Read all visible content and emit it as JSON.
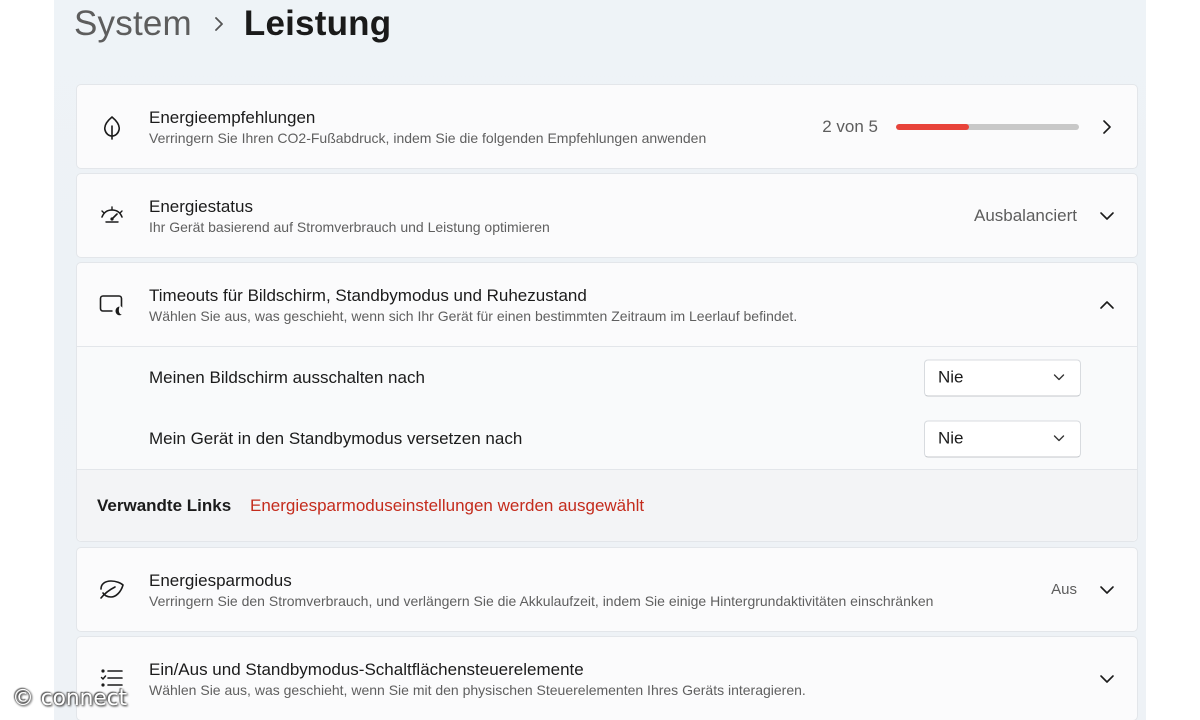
{
  "breadcrumb": {
    "parent": "System",
    "current": "Leistung"
  },
  "cards": {
    "recommendations": {
      "icon": "leaf-icon",
      "title": "Energieempfehlungen",
      "subtitle": "Verringern Sie Ihren CO2-Fußabdruck, indem Sie die folgenden Empfehlungen anwenden",
      "progress_text": "2 von 5",
      "progress_fraction": 0.4,
      "progress_color": "#e8433a",
      "progress_track_color": "#c8c8c8"
    },
    "power_mode": {
      "icon": "gauge-icon",
      "title": "Energiestatus",
      "subtitle": "Ihr Gerät basierend auf Stromverbrauch und Leistung optimieren",
      "value": "Ausbalanciert"
    },
    "timeouts": {
      "icon": "screen-moon-icon",
      "title": "Timeouts für Bildschirm, Standbymodus und Ruhezustand",
      "subtitle": "Wählen Sie aus, was geschieht, wenn sich Ihr Gerät für einen bestimmten Zeitraum im Leerlauf befindet.",
      "rows": [
        {
          "label": "Meinen Bildschirm ausschalten nach",
          "value": "Nie"
        },
        {
          "label": "Mein Gerät in den Standbymodus versetzen nach",
          "value": "Nie"
        }
      ],
      "related": {
        "label": "Verwandte Links",
        "link": "Energiesparmoduseinstellungen werden ausgewählt",
        "link_color": "#c42b1c"
      }
    },
    "battery_saver": {
      "icon": "battery-saver-leaf-icon",
      "title": "Energiesparmodus",
      "subtitle": "Verringern Sie den Stromverbrauch, und verlängern Sie die Akkulaufzeit, indem Sie einige Hintergrundaktivitäten einschränken",
      "value": "Aus"
    },
    "buttons": {
      "icon": "list-icon",
      "title": "Ein/Aus und Standbymodus-Schaltflächensteuerelemente",
      "subtitle": "Wählen Sie aus, was geschieht, wenn Sie mit den physischen Steuerelementen Ihres Geräts interagieren."
    }
  },
  "watermark": "© connect"
}
